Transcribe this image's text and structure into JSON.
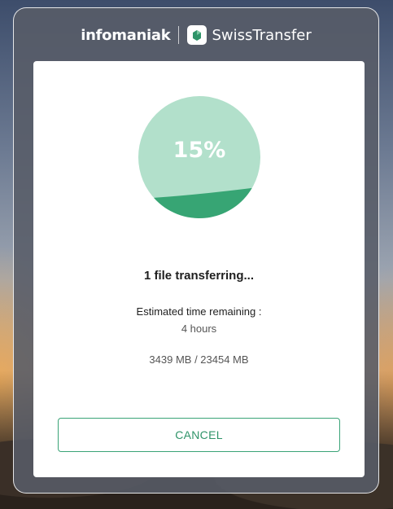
{
  "brand": {
    "company": "infomaniak",
    "product": "SwissTransfer"
  },
  "progress": {
    "percent_label": "15%",
    "fraction": 0.15,
    "colors": {
      "track": "#b2e0cb",
      "fill": "#37a574"
    }
  },
  "transfer": {
    "status": "1 file transferring...",
    "eta_label": "Estimated time remaining :",
    "eta_value": "4 hours",
    "sizes": "3439 MB / 23454 MB"
  },
  "actions": {
    "cancel_label": "CANCEL"
  },
  "colors": {
    "accent": "#2f9469",
    "panel": "#585c68",
    "card": "#ffffff"
  }
}
